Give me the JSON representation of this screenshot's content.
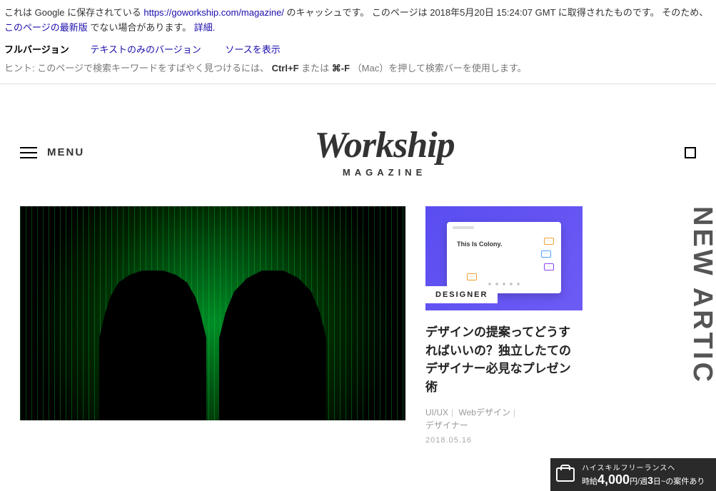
{
  "cache": {
    "line1_pre": "これは Google に保存されている ",
    "url": "https://goworkship.com/magazine/",
    "line1_post": " のキャッシュです。 このページは 2018年5月20日 15:24:07 GMT に取得されたものです。 そのため、",
    "latest_link": "このページの最新版",
    "line1_end": "でない場合があります。 ",
    "details": "詳細.",
    "tabs": {
      "full": "フルバージョン",
      "text": "テキストのみのバージョン",
      "source": "ソースを表示"
    },
    "hint_pre": "ヒント: このページで検索キーワードをすばやく見つけるには、",
    "hint_kb1": "Ctrl+F",
    "hint_mid": " または ",
    "hint_kb2": "⌘-F",
    "hint_post": "（Mac）を押して検索バーを使用します。"
  },
  "header": {
    "menu_label": "MENU",
    "logo_main": "Workship",
    "logo_sub": "MAGAZINE"
  },
  "side": {
    "label": "NEW ARTIC"
  },
  "article": {
    "category": "DESIGNER",
    "mock_hero": "This Is Colony.",
    "title": "デザインの提案ってどうすればいいの？独立したてのデザイナー必見なプレゼン術",
    "tags": [
      "UI/UX",
      "Webデザイン",
      "デザイナー"
    ],
    "date": "2018.05.16"
  },
  "ad": {
    "top": "ハイスキルフリーランスへ",
    "price_big": "4,000",
    "price_unit": "円/週",
    "days_big": "3",
    "days_post": "日~の案件あり",
    "prefix": "時給"
  }
}
